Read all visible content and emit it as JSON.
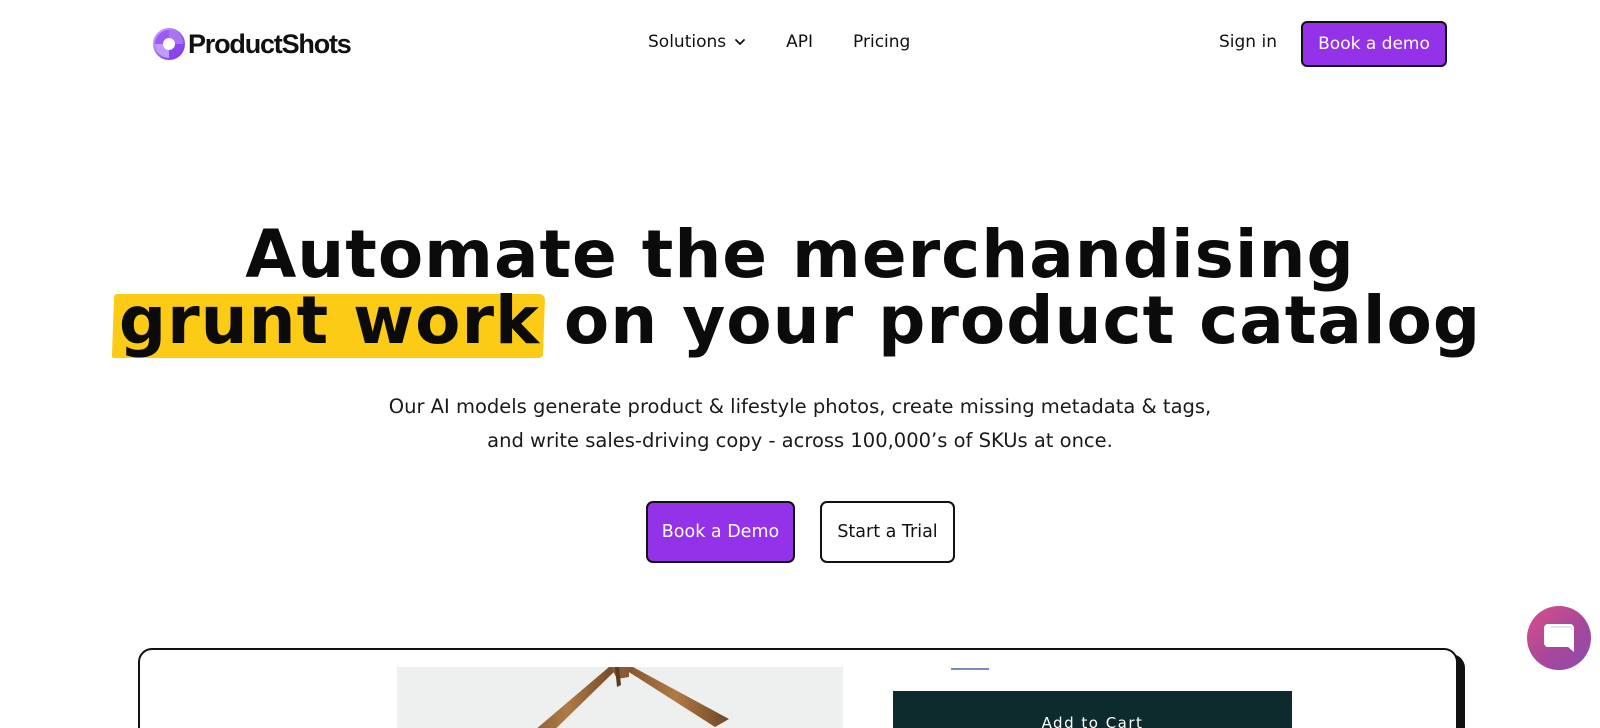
{
  "brand": {
    "name": "ProductShots",
    "accent_color": "#9332e8",
    "highlight_color": "#fbcb16"
  },
  "nav": {
    "links": [
      {
        "label": "Solutions",
        "icon": "chevron-down-icon"
      },
      {
        "label": "API"
      },
      {
        "label": "Pricing"
      }
    ],
    "sign_in": "Sign in",
    "book_demo": "Book a demo"
  },
  "hero": {
    "title_line1": "Automate the merchandising",
    "title_highlight": "grunt work",
    "title_line2_rest": " on your product catalog",
    "subtitle_line1": "Our AI models generate product & lifestyle photos, create missing metadata & tags,",
    "subtitle_line2": "and write sales-driving copy - across 100,000’s of SKUs at once.",
    "cta_primary": "Book a Demo",
    "cta_secondary": "Start a Trial"
  },
  "demo": {
    "add_to_cart": "Add to Cart",
    "cart_button_color": "#0d2a2c"
  },
  "chat": {
    "icon": "chat-bubble-icon"
  }
}
